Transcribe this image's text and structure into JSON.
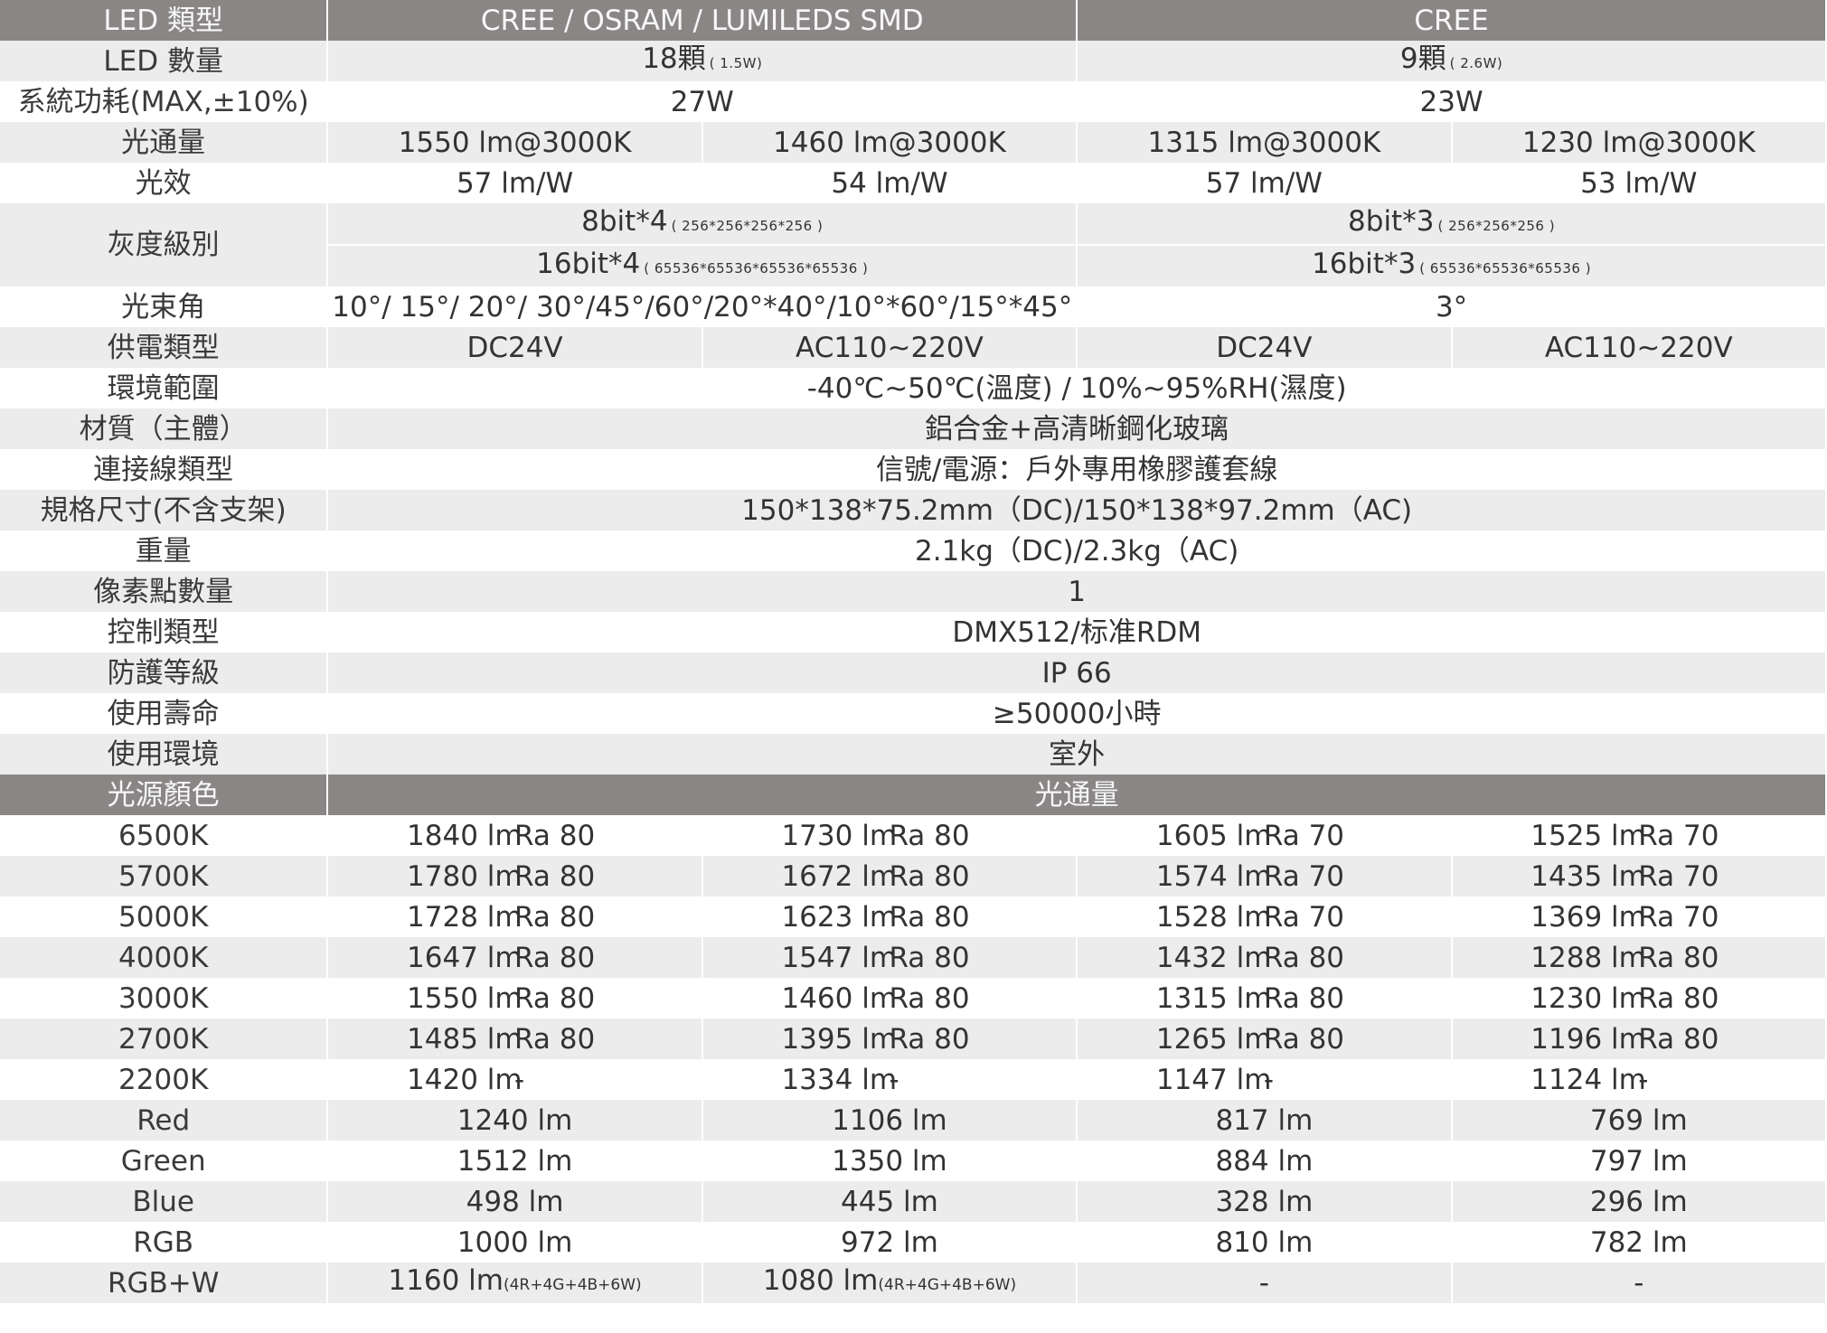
{
  "header": {
    "label": "LED 類型",
    "group_a": "CREE / OSRAM / LUMILEDS SMD",
    "group_b": "CREE"
  },
  "led_qty": {
    "label": "LED 數量",
    "a": "18顆",
    "a_note": "( 1.5W)",
    "b": "9顆",
    "b_note": "( 2.6W)"
  },
  "power": {
    "label": "系統功耗(MAX,±10%)",
    "a": "27W",
    "b": "23W"
  },
  "flux": {
    "label": "光通量",
    "v": [
      "1550 lm@3000K",
      "1460 lm@3000K",
      "1315 lm@3000K",
      "1230 lm@3000K"
    ]
  },
  "efficacy": {
    "label": "光效",
    "v": [
      "57 lm/W",
      "54 lm/W",
      "57 lm/W",
      "53 lm/W"
    ]
  },
  "grayscale": {
    "label": "灰度級別",
    "a1": "8bit*4",
    "a1_note": "( 256*256*256*256 )",
    "a2": "16bit*4",
    "a2_note": "( 65536*65536*65536*65536 )",
    "b1": "8bit*3",
    "b1_note": "( 256*256*256 )",
    "b2": "16bit*3",
    "b2_note": "( 65536*65536*65536 )"
  },
  "beam": {
    "label": "光束角",
    "a": "10°/ 15°/ 20°/ 30°/45°/60°/20°*40°/10°*60°/15°*45°",
    "b": "3°"
  },
  "supply": {
    "label": "供電類型",
    "v": [
      "DC24V",
      "AC110~220V",
      "DC24V",
      "AC110~220V"
    ]
  },
  "specs": [
    {
      "label": "環境範圍",
      "value": "-40℃~50℃(溫度) / 10%~95%RH(濕度)"
    },
    {
      "label": "材質（主體）",
      "value": "鋁合金+高清晰鋼化玻璃"
    },
    {
      "label": "連接線類型",
      "value": "信號/電源：戶外專用橡膠護套線"
    },
    {
      "label": "規格尺寸(不含支架)",
      "value": "150*138*75.2mm（DC)/150*138*97.2mm（AC)"
    },
    {
      "label": "重量",
      "value": "2.1kg（DC)/2.3kg（AC)"
    },
    {
      "label": "像素點數量",
      "value": "1"
    },
    {
      "label": "控制類型",
      "value": "DMX512/标准RDM"
    },
    {
      "label": "防護等級",
      "value": "IP 66"
    },
    {
      "label": "使用壽命",
      "value": "≥50000小時"
    },
    {
      "label": "使用環境",
      "value": "室外"
    }
  ],
  "color_header": {
    "label": "光源顏色",
    "value": "光通量"
  },
  "colors": [
    {
      "label": "6500K",
      "lm": [
        "1840 lm",
        "1730 lm",
        "1605 lm",
        "1525 lm"
      ],
      "ra": [
        "Ra 80",
        "Ra 80",
        "Ra 70",
        "Ra 70"
      ]
    },
    {
      "label": "5700K",
      "lm": [
        "1780 lm",
        "1672 lm",
        "1574 lm",
        "1435 lm"
      ],
      "ra": [
        "Ra 80",
        "Ra 80",
        "Ra 70",
        "Ra 70"
      ]
    },
    {
      "label": "5000K",
      "lm": [
        "1728 lm",
        "1623 lm",
        "1528 lm",
        "1369 lm"
      ],
      "ra": [
        "Ra 80",
        "Ra 80",
        "Ra 70",
        "Ra 70"
      ]
    },
    {
      "label": "4000K",
      "lm": [
        "1647 lm",
        "1547 lm",
        "1432 lm",
        "1288 lm"
      ],
      "ra": [
        "Ra 80",
        "Ra 80",
        "Ra 80",
        "Ra 80"
      ]
    },
    {
      "label": "3000K",
      "lm": [
        "1550 lm",
        "1460 lm",
        "1315 lm",
        "1230 lm"
      ],
      "ra": [
        "Ra 80",
        "Ra 80",
        "Ra 80",
        "Ra 80"
      ]
    },
    {
      "label": "2700K",
      "lm": [
        "1485 lm",
        "1395 lm",
        "1265 lm",
        "1196 lm"
      ],
      "ra": [
        "Ra 80",
        "Ra 80",
        "Ra 80",
        "Ra 80"
      ]
    },
    {
      "label": "2200K",
      "lm": [
        "1420 lm",
        "1334 lm",
        "1147 lm",
        "1124 lm"
      ],
      "ra": [
        "-",
        "-",
        "-",
        "-"
      ]
    }
  ],
  "singles": [
    {
      "label": "Red",
      "v": [
        "1240 lm",
        "1106 lm",
        "817 lm",
        "769 lm"
      ]
    },
    {
      "label": "Green",
      "v": [
        "1512 lm",
        "1350 lm",
        "884 lm",
        "797 lm"
      ]
    },
    {
      "label": "Blue",
      "v": [
        "498 lm",
        "445 lm",
        "328 lm",
        "296 lm"
      ]
    },
    {
      "label": "RGB",
      "v": [
        "1000 lm",
        "972 lm",
        "810 lm",
        "782 lm"
      ]
    }
  ],
  "rgbw": {
    "label": "RGB+W",
    "v1": "1160 lm",
    "v2": "1080 lm",
    "note": "(4R+4G+4B+6W)",
    "v3": "-",
    "v4": "-"
  }
}
